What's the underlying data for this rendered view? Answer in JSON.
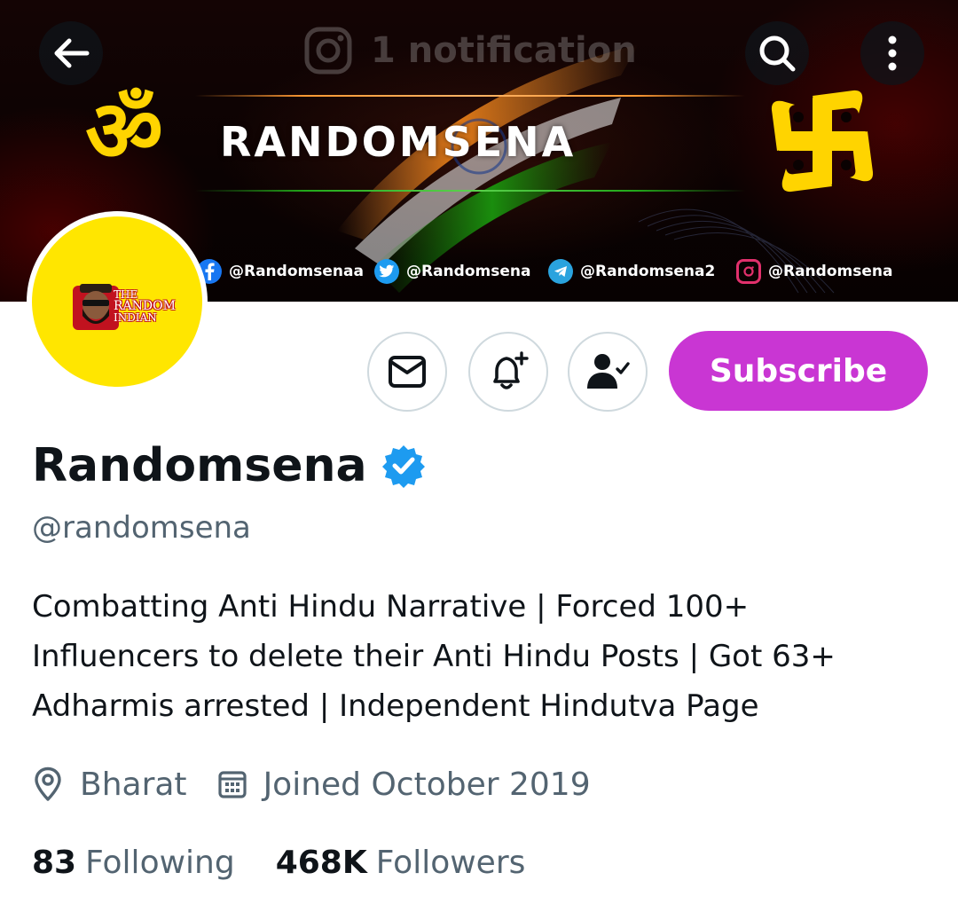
{
  "header": {
    "notification_text": "1 notification"
  },
  "banner": {
    "brand": "RANDOMSENA",
    "om_symbol": "ॐ",
    "socials": [
      {
        "network": "facebook",
        "handle": "@Randomsenaa",
        "color": "#1877f2"
      },
      {
        "network": "twitter",
        "handle": "@Randomsena",
        "color": "#1d9bf0"
      },
      {
        "network": "telegram",
        "handle": "@Randomsena2",
        "color": "#2aa3de"
      },
      {
        "network": "instagram",
        "handle": "@Randomsena",
        "color": "#e1306c"
      }
    ]
  },
  "avatar": {
    "logo_lines": [
      "THE",
      "RANDOM",
      "INDIAN"
    ],
    "background_color": "#ffe600"
  },
  "actions": {
    "subscribe_label": "Subscribe",
    "subscribe_color": "#c936d3",
    "icons": [
      "mail-icon",
      "bell-plus-icon",
      "person-check-icon"
    ]
  },
  "profile": {
    "display_name": "Randomsena",
    "verified": true,
    "verified_color": "#1d9bf0",
    "handle": "@randomsena",
    "bio_lines": [
      "Combatting Anti Hindu Narrative | Forced 100+",
      "Influencers to delete their Anti Hindu Posts | Got 63+",
      "Adharmis arrested | Independent Hindutva Page"
    ],
    "location": "Bharat",
    "joined": "Joined October 2019"
  },
  "stats": {
    "following_count": "83",
    "following_label": "Following",
    "followers_count": "468K",
    "followers_label": "Followers"
  }
}
